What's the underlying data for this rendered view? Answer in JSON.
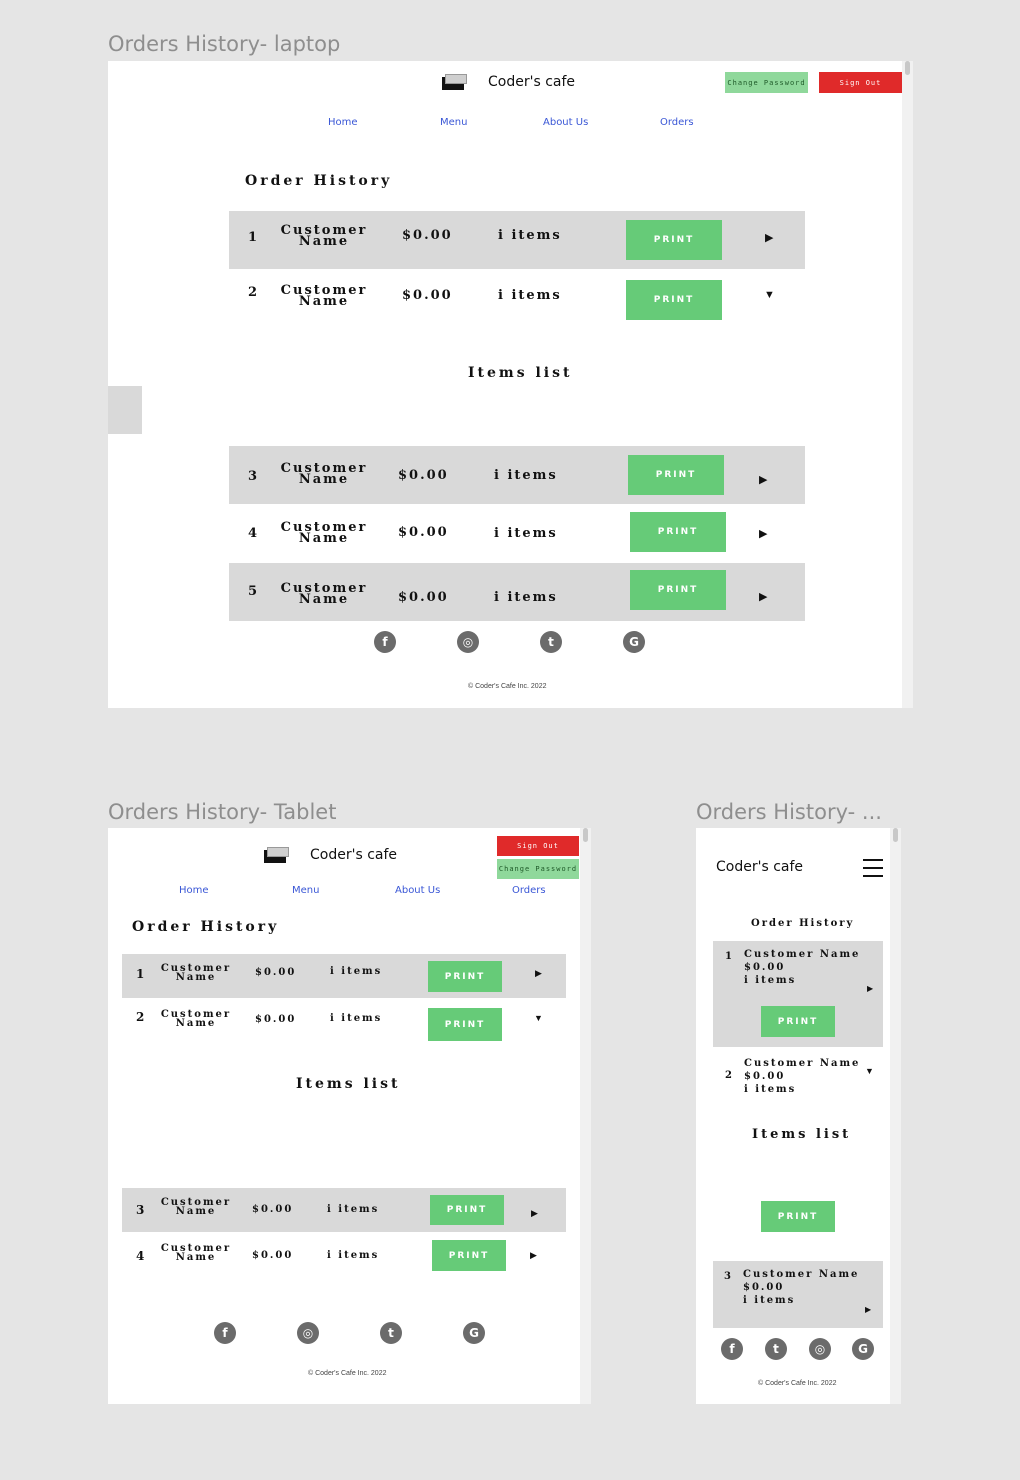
{
  "frames": {
    "laptop": "Orders History- laptop",
    "tablet": "Orders History- Tablet",
    "mobile": "Orders History- ..."
  },
  "brand": {
    "name": "Coder's cafe",
    "logo_icon": "cube-logo-icon"
  },
  "header": {
    "change_password": "Change Password",
    "sign_out": "Sign Out"
  },
  "nav": [
    "Home",
    "Menu",
    "About Us",
    "Orders"
  ],
  "page": {
    "title": "Order History",
    "items_list": "Items list"
  },
  "orders": [
    {
      "num": "1",
      "name_line1": "Customer",
      "name_line2": "Name",
      "full_name": "Customer Name",
      "total": "$0.00",
      "items": "i items",
      "print": "PRINT",
      "expanded": false
    },
    {
      "num": "2",
      "name_line1": "Customer",
      "name_line2": "Name",
      "full_name": "Customer Name",
      "total": "$0.00",
      "items": "i items",
      "print": "PRINT",
      "expanded": true
    },
    {
      "num": "3",
      "name_line1": "Customer",
      "name_line2": "Name",
      "full_name": "Customer Name",
      "total": "$0.00",
      "items": "i items",
      "print": "PRINT",
      "expanded": false
    },
    {
      "num": "4",
      "name_line1": "Customer",
      "name_line2": "Name",
      "full_name": "Customer Name",
      "total": "$0.00",
      "items": "i items",
      "print": "PRINT",
      "expanded": false
    },
    {
      "num": "5",
      "name_line1": "Customer",
      "name_line2": "Name",
      "full_name": "Customer Name",
      "total": "$0.00",
      "items": "i items",
      "print": "PRINT",
      "expanded": false
    }
  ],
  "arrows": {
    "collapsed": "▶",
    "expanded": "▼"
  },
  "social": {
    "facebook": "f",
    "instagram": "◎",
    "twitter": "t",
    "google": "G"
  },
  "footer": {
    "copyright": "© Coder's Cafe Inc. 2022"
  },
  "colors": {
    "sign_out": "#e02a2a",
    "change_password": "#8fd89b",
    "print": "#66cb78",
    "row_shade": "#d9d9d9",
    "nav_link": "#3a57d6"
  }
}
